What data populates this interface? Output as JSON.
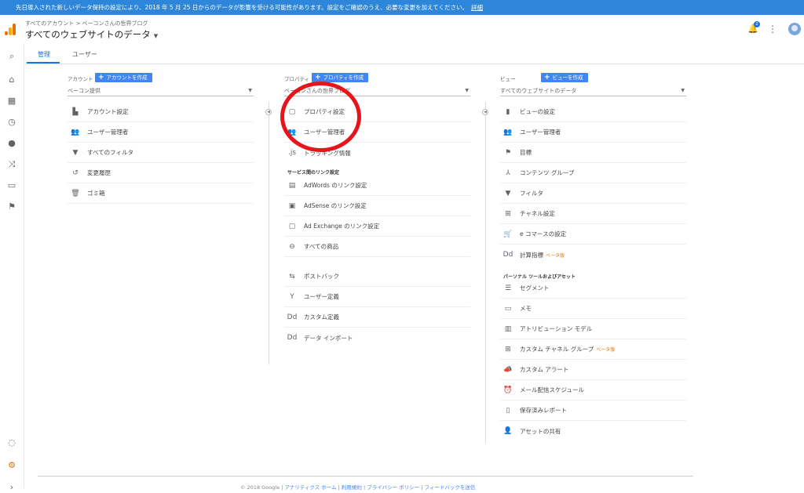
{
  "banner": {
    "text": "先日導入された新しいデータ保持の設定により、2018 年 5 月 25 日からのデータが影響を受ける可能性があります。設定をご確認のうえ、必要な変更を加えてください。",
    "link": "詳細"
  },
  "header": {
    "breadcrumb": "すべてのアカウント > ベーコンさんの哲界ブログ",
    "title": "すべてのウェブサイトのデータ",
    "notification_count": "2"
  },
  "tabs": [
    {
      "label": "管理"
    },
    {
      "label": "ユーザー"
    }
  ],
  "account": {
    "heading": "アカウント",
    "create_label": "アカウントを作成",
    "selected": "ベーコン提供",
    "items": [
      {
        "label": "アカウント設定"
      },
      {
        "label": "ユーザー管理者"
      },
      {
        "label": "すべてのフィルタ"
      },
      {
        "label": "変更履歴"
      },
      {
        "label": "ゴミ箱"
      }
    ]
  },
  "property": {
    "heading": "プロパティ",
    "create_label": "プロパティを作成",
    "selected": "ベーコンさんの哲界ブログ",
    "items": [
      {
        "label": "プロパティ設定"
      },
      {
        "label": "ユーザー管理者"
      },
      {
        "label": "トラッキング情報"
      }
    ],
    "link_section": "サービス間のリンク設定",
    "links": [
      {
        "label": "AdWords のリンク設定"
      },
      {
        "label": "AdSense のリンク設定"
      },
      {
        "label": "Ad Exchange のリンク設定"
      },
      {
        "label": "すべての商品"
      }
    ],
    "more": [
      {
        "label": "ポストバック"
      },
      {
        "label": "ユーザー定義"
      },
      {
        "label": "カスタム定義"
      },
      {
        "label": "データ インポート"
      }
    ]
  },
  "view": {
    "heading": "ビュー",
    "create_label": "ビューを作成",
    "selected": "すべてのウェブサイトのデータ",
    "items": [
      {
        "label": "ビューの設定"
      },
      {
        "label": "ユーザー管理者"
      },
      {
        "label": "目標"
      },
      {
        "label": "コンテンツ グループ"
      },
      {
        "label": "フィルタ"
      },
      {
        "label": "チャネル設定"
      },
      {
        "label": "e コマースの設定"
      },
      {
        "label": "計算指標",
        "beta": "ベータ版"
      }
    ],
    "personal_section": "パーソナル ツールおよびアセット",
    "personal": [
      {
        "label": "セグメント"
      },
      {
        "label": "メモ"
      },
      {
        "label": "アトリビューション モデル"
      },
      {
        "label": "カスタム チャネル グループ",
        "beta": "ベータ版"
      },
      {
        "label": "カスタム アラート"
      },
      {
        "label": "メール配信スケジュール"
      },
      {
        "label": "保存済みレポート"
      },
      {
        "label": "アセットの共有"
      }
    ]
  },
  "footer": {
    "copyright": "© 2018 Google |",
    "links": [
      "アナリティクス ホーム",
      "利用規約",
      "プライバシー ポリシー",
      "フィードバックを送信"
    ]
  }
}
